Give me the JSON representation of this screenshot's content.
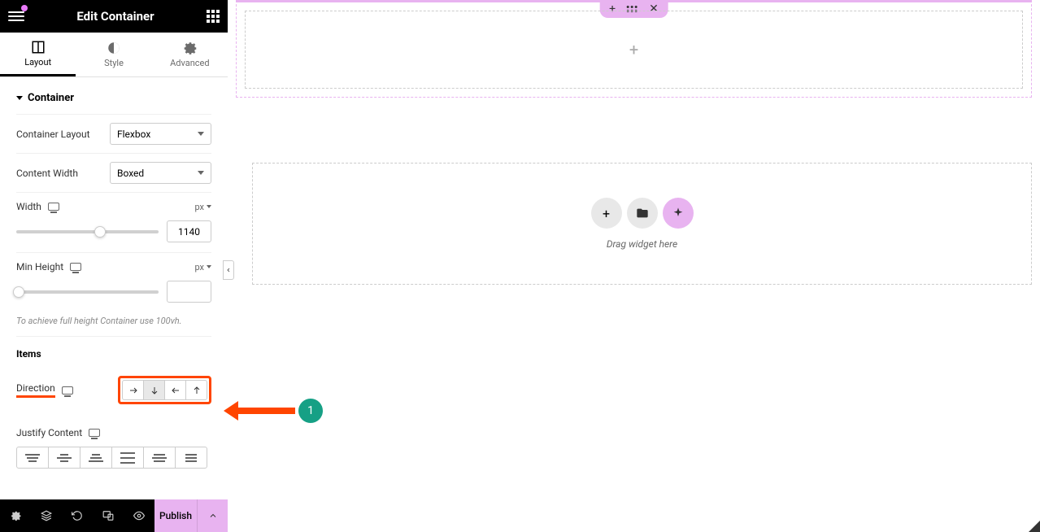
{
  "header": {
    "title": "Edit Container"
  },
  "tabs": {
    "layout": "Layout",
    "style": "Style",
    "advanced": "Advanced"
  },
  "sections": {
    "container": "Container",
    "items": "Items"
  },
  "controls": {
    "container_layout": {
      "label": "Container Layout",
      "value": "Flexbox"
    },
    "content_width": {
      "label": "Content Width",
      "value": "Boxed"
    },
    "width": {
      "label": "Width",
      "unit": "px",
      "value": "1140"
    },
    "min_height": {
      "label": "Min Height",
      "unit": "px",
      "value": ""
    },
    "height_help": "To achieve full height Container use 100vh.",
    "direction": {
      "label": "Direction"
    },
    "justify_content": {
      "label": "Justify Content"
    }
  },
  "bottom": {
    "publish": "Publish"
  },
  "canvas": {
    "drag_text": "Drag widget here"
  },
  "annotation": {
    "number": "1"
  }
}
